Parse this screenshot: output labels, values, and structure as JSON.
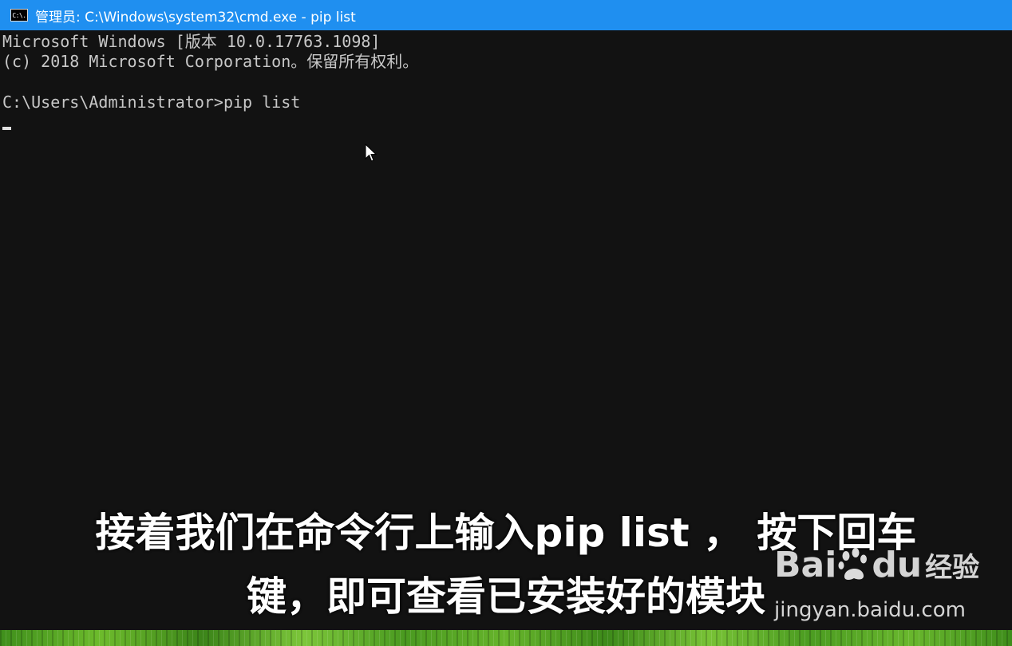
{
  "window": {
    "title": "管理员: C:\\Windows\\system32\\cmd.exe - pip  list",
    "icon_text": "C:\\.",
    "accent_color": "#1f8ff0"
  },
  "console": {
    "lines": [
      "Microsoft Windows [版本 10.0.17763.1098]",
      "(c) 2018 Microsoft Corporation。保留所有权利。",
      "",
      "C:\\Users\\Administrator>pip list"
    ]
  },
  "subtitles": {
    "line1": "接着我们在命令行上输入pip list ， 按下回车",
    "line2": "键，即可查看已安装好的模块"
  },
  "watermark": {
    "logo_part1": "Bai",
    "logo_part2": "du",
    "brand": "经验",
    "url": "jingyan.baidu.com",
    "paw_icon": "baidu-paw-icon"
  }
}
